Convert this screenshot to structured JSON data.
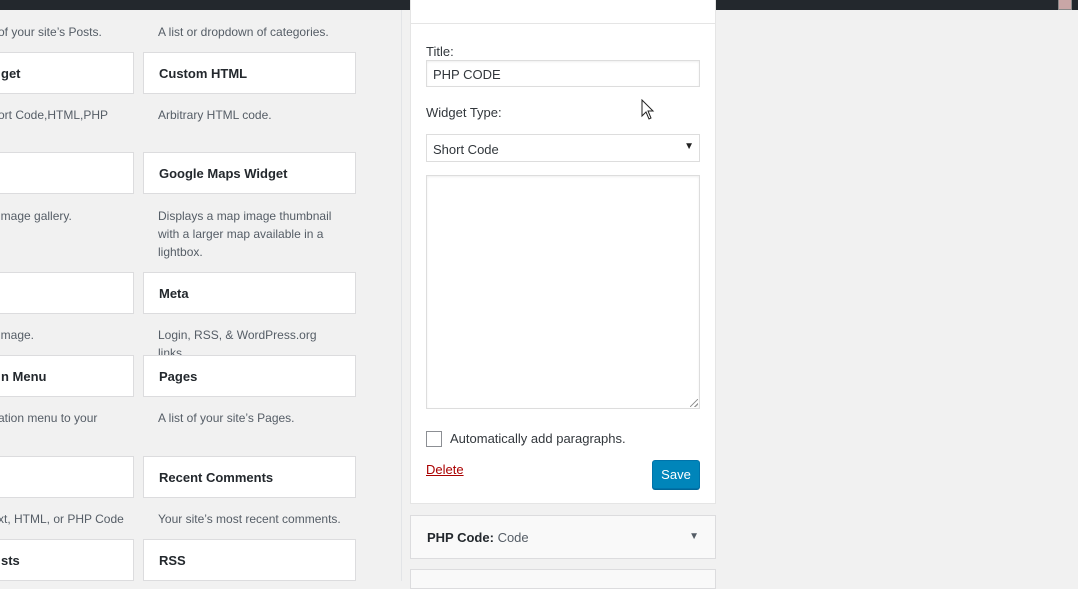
{
  "available_widgets": {
    "col1": [
      {
        "title": "",
        "desc": "of your site’s Posts."
      },
      {
        "title": "get",
        "desc": "ort Code,HTML,PHP"
      },
      {
        "title": "",
        "desc": "image gallery."
      },
      {
        "title": "",
        "desc": "image."
      },
      {
        "title": "n Menu",
        "desc": "ation menu to your"
      },
      {
        "title": "",
        "desc": "xt, HTML, or PHP Code"
      },
      {
        "title": "sts",
        "desc": ""
      }
    ],
    "col2": [
      {
        "title": "",
        "desc": "A list or dropdown of categories."
      },
      {
        "title": "Custom HTML",
        "desc": "Arbitrary HTML code."
      },
      {
        "title": "Google Maps Widget",
        "desc": "Displays a map image thumbnail with a larger map available in a lightbox."
      },
      {
        "title": "Meta",
        "desc": "Login, RSS, & WordPress.org links."
      },
      {
        "title": "Pages",
        "desc": "A list of your site’s Pages."
      },
      {
        "title": "Recent Comments",
        "desc": "Your site’s most recent comments."
      },
      {
        "title": "RSS",
        "desc": ""
      }
    ]
  },
  "editor": {
    "title_label": "Title:",
    "title_value": "PHP CODE",
    "widget_type_label": "Widget Type:",
    "widget_type_value": "Short Code",
    "auto_paragraphs_label": "Automatically add paragraphs.",
    "delete_label": "Delete",
    "save_label": "Save"
  },
  "collapsed_widget": {
    "title": "PHP Code:",
    "subtitle": "Code"
  },
  "icons": {
    "select_arrow": "▼",
    "collapse_arrow": "▼"
  },
  "colors": {
    "admin_bar": "#23282d",
    "primary_button": "#0085ba",
    "delete_link": "#a00"
  }
}
